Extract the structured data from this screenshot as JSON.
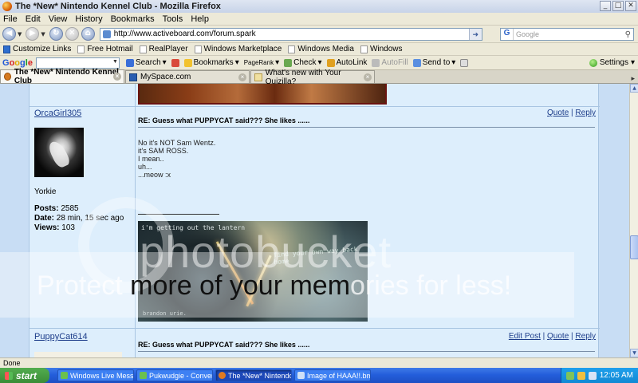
{
  "window": {
    "title": "The *New* Nintendo Kennel Club - Mozilla Firefox"
  },
  "menu": [
    "File",
    "Edit",
    "View",
    "History",
    "Bookmarks",
    "Tools",
    "Help"
  ],
  "nav": {
    "url": "http://www.activeboard.com/forum.spark",
    "search_placeholder": "Google"
  },
  "bookmarks": [
    "Customize Links",
    "Free Hotmail",
    "RealPlayer",
    "Windows Marketplace",
    "Windows Media",
    "Windows"
  ],
  "google_toolbar": {
    "logo": [
      "G",
      "o",
      "o",
      "g",
      "l",
      "e"
    ],
    "items": [
      "Search",
      "Bookmarks",
      "PageRank",
      "Check",
      "AutoLink",
      "AutoFill",
      "Send to"
    ],
    "settings": "Settings"
  },
  "tabs": [
    {
      "label": "The *New* Nintendo Kennel Club",
      "active": true
    },
    {
      "label": "MySpace.com",
      "active": false
    },
    {
      "label": "What's new with Your Quizilla?",
      "active": false
    }
  ],
  "posts": [
    {
      "author": "OrcaGirl305",
      "rank": "Yorkie",
      "stats": {
        "posts_label": "Posts:",
        "posts": "2585",
        "date_label": "Date:",
        "date": "28 min, 15 sec ago",
        "views_label": "Views:",
        "views": "103"
      },
      "subject": "RE: Guess what PUPPYCAT said??? She likes ......",
      "actions": [
        "Quote",
        "Reply"
      ],
      "body": [
        "No it's NOT Sam Wentz.",
        "it's SAM ROSS.",
        "I mean..",
        "uh...",
        "...meow :x"
      ],
      "signature_text": [
        "i'm getting out the lantern",
        "find your own way back home",
        "brandon urie."
      ]
    },
    {
      "author": "PuppyCat614",
      "subject": "RE: Guess what PUPPYCAT said??? She likes ......",
      "actions": [
        "Edit Post",
        "Quote",
        "Reply"
      ]
    }
  ],
  "watermark": {
    "logo": "photobucket",
    "band": "Protect",
    "band_mid": "more of your mem",
    "band_end": "ories for less!"
  },
  "status": "Done",
  "taskbar": {
    "start": "start",
    "tasks": [
      "Windows Live Messen...",
      "Pukwudgie - Convers...",
      "The *New* Nintendo ...",
      "Image of HAAA!!.bm..."
    ],
    "clock": "12:05 AM"
  },
  "colors": {
    "forum_bg": "#ddeefc",
    "page_bg": "#c8ddf4",
    "link": "#1d3d8a",
    "taskbar": "#245edb"
  }
}
